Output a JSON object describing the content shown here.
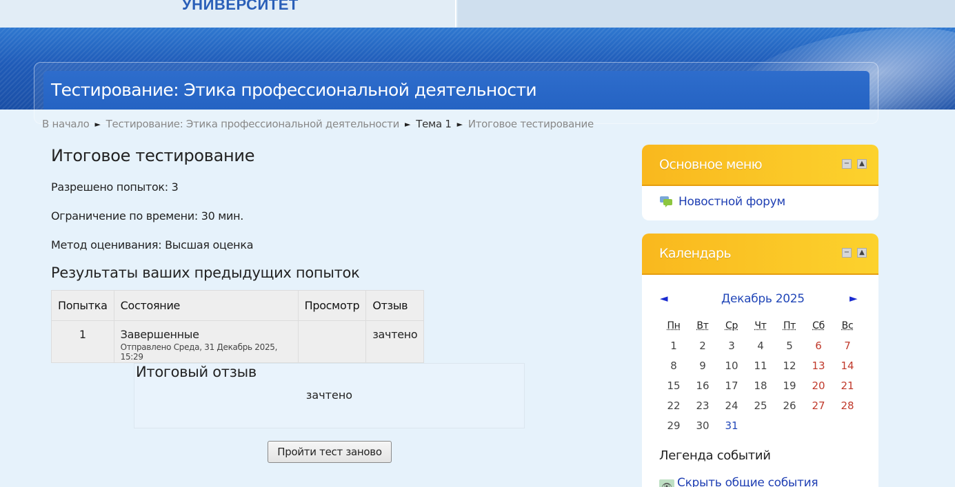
{
  "header": {
    "logo_text": "УНИВЕРСИТЕТ",
    "course_title": "Тестирование: Этика профессиональной деятельности"
  },
  "breadcrumb": {
    "home": "В начало",
    "course": "Тестирование: Этика профессиональной деятельности",
    "section": "Тема 1",
    "current": "Итоговое тестирование"
  },
  "main": {
    "heading": "Итоговое тестирование",
    "attempts_allowed": "Разрешено попыток: 3",
    "time_limit": "Ограничение по времени: 30 мин.",
    "grading_method": "Метод оценивания: Высшая оценка",
    "results_heading": "Результаты ваших предыдущих попыток",
    "table": {
      "headers": [
        "Попытка",
        "Состояние",
        "Просмотр",
        "Отзыв"
      ],
      "rows": [
        {
          "attempt": "1",
          "state": "Завершенные",
          "submitted": "Отправлено Среда, 31 Декабрь 2025, 15:29",
          "review": "",
          "feedback": "зачтено"
        }
      ]
    },
    "overall_feedback": {
      "title": "Итоговый отзыв",
      "value": "зачтено"
    },
    "retake_button": "Пройти тест заново"
  },
  "sidebar": {
    "main_menu": {
      "title": "Основное меню",
      "forum_link": "Новостной форум"
    },
    "calendar": {
      "title": "Календарь",
      "prev": "◄",
      "month": "Декабрь 2025",
      "next": "►",
      "weekdays": [
        "Пн",
        "Вт",
        "Ср",
        "Чт",
        "Пт",
        "Сб",
        "Вс"
      ],
      "weeks": [
        [
          "1",
          "2",
          "3",
          "4",
          "5",
          "6",
          "7"
        ],
        [
          "8",
          "9",
          "10",
          "11",
          "12",
          "13",
          "14"
        ],
        [
          "15",
          "16",
          "17",
          "18",
          "19",
          "20",
          "21"
        ],
        [
          "22",
          "23",
          "24",
          "25",
          "26",
          "27",
          "28"
        ],
        [
          "29",
          "30",
          "31",
          "",
          "",
          "",
          ""
        ]
      ],
      "legend_title": "Легенда событий",
      "legend_link": "Скрыть общие события"
    }
  },
  "colors": {
    "banner_blue": "#1f5bb8",
    "block_header": "#fcc72a",
    "link": "#1f3fb3",
    "weekend": "#c0392b"
  }
}
